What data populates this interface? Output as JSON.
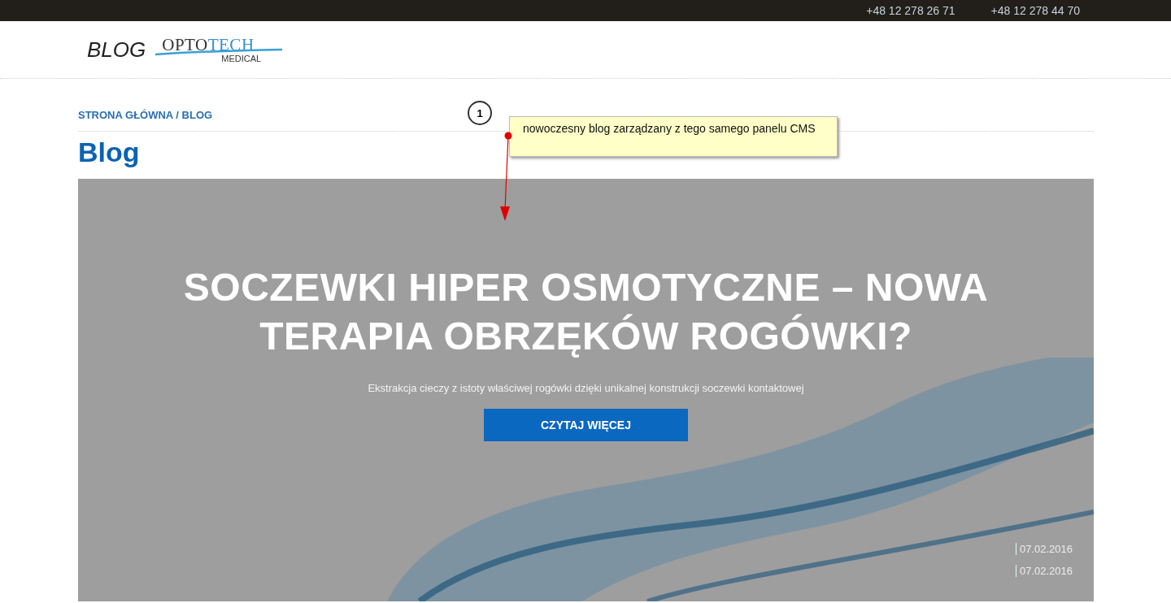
{
  "top_bar": {
    "phones": [
      "+48 12 278 26 71",
      "+48 12 278 44 70"
    ]
  },
  "header": {
    "blog_label": "BLOG",
    "logo": {
      "wordmark_parts": [
        "OPTO",
        "TECH"
      ],
      "subtitle": "MEDICAL"
    }
  },
  "breadcrumb": "STRONA GŁÓWNA / BLOG",
  "page_title": "Blog",
  "hero": {
    "title": "SOCZEWKI HIPER OSMOTYCZNE – NOWA TERAPIA OBRZĘKÓW ROGÓWKI?",
    "subtitle": "Ekstrakcja cieczy z istoty właściwej rogówki dzięki unikalnej konstrukcji soczewki kontaktowej",
    "button": "CZYTAJ WIĘCEJ",
    "dates": [
      "07.02.2016",
      "07.02.2016"
    ]
  },
  "annotation": {
    "number": "1",
    "note": "nowoczesny blog zarządzany z tego samego panelu CMS"
  }
}
